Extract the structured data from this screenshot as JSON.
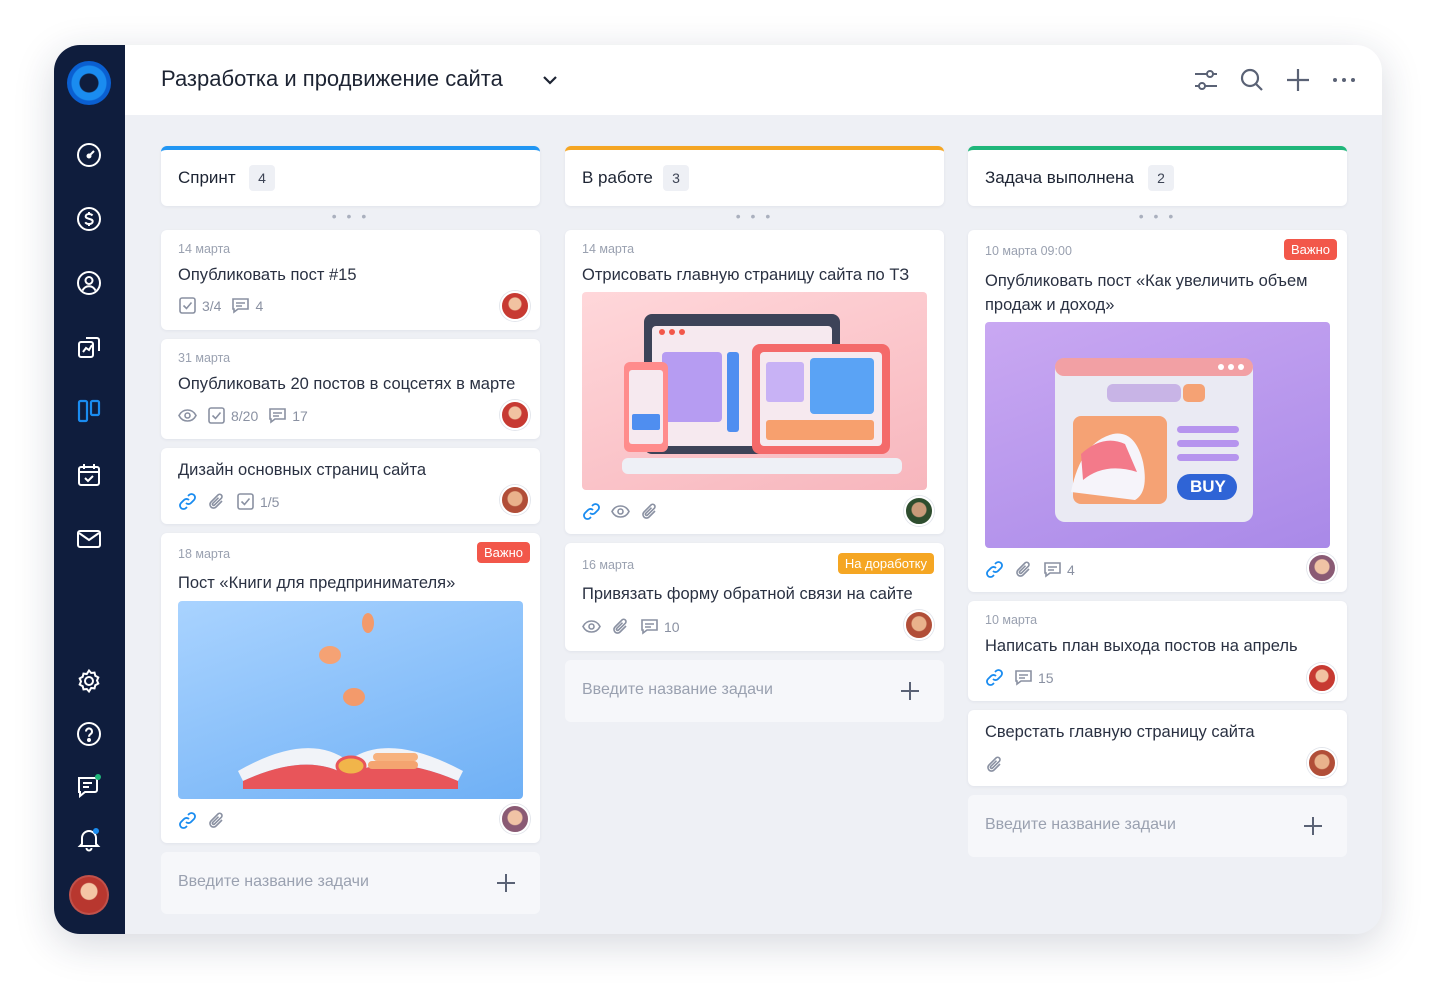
{
  "header": {
    "title": "Разработка и продвижение сайта"
  },
  "columns": [
    {
      "title": "Спринт",
      "count": "4",
      "accent": "#2196f3",
      "cards": [
        {
          "date": "14 марта",
          "title": "Опубликовать пост #15",
          "checklist": "3/4",
          "comments": "4"
        },
        {
          "date": "31 марта",
          "title": "Опубликовать 20 постов в соцсетях в марте",
          "checklist": "8/20",
          "comments": "17"
        },
        {
          "title": "Дизайн основных страниц сайта",
          "checklist": "1/5"
        },
        {
          "date": "18 марта",
          "title": "Пост «Книги для предпринимателя»",
          "badge": "Важно"
        }
      ],
      "add_placeholder": "Введите название задачи"
    },
    {
      "title": "В работе",
      "count": "3",
      "accent": "#f5a623",
      "cards": [
        {
          "date": "14 марта",
          "title": "Отрисовать главную страницу сайта по ТЗ"
        },
        {
          "date": "16 марта",
          "title": "Привязать форму обратной связи на сайте",
          "badge": "На доработку",
          "comments": "10"
        }
      ],
      "add_placeholder": "Введите название задачи"
    },
    {
      "title": "Задача выполнена",
      "count": "2",
      "accent": "#1fb67a",
      "cards": [
        {
          "date": "10 марта 09:00",
          "title": "Опубликовать пост «Как увеличить объем продаж и доход»",
          "badge": "Важно",
          "comments": "4",
          "image_button": "BUY"
        },
        {
          "date": "10 марта",
          "title": "Написать план выхода постов на апрель",
          "comments": "15"
        },
        {
          "title": "Сверстать главную страницу сайта"
        }
      ],
      "add_placeholder": "Введите название задачи"
    }
  ],
  "colors": {
    "sidebar": "#0f1d3d",
    "badge_important": "#f2574a",
    "badge_rework": "#f5a623",
    "active_nav": "#1a8cf0"
  },
  "icons": {
    "sidebar": [
      "logo-icon",
      "dashboard-icon",
      "dollar-icon",
      "user-circle-icon",
      "chart-icon",
      "board-icon",
      "calendar-icon",
      "mail-icon",
      "settings-icon",
      "help-icon",
      "chat-icon",
      "bell-icon"
    ],
    "header": [
      "filter-icon",
      "search-icon",
      "plus-icon",
      "more-icon"
    ]
  }
}
